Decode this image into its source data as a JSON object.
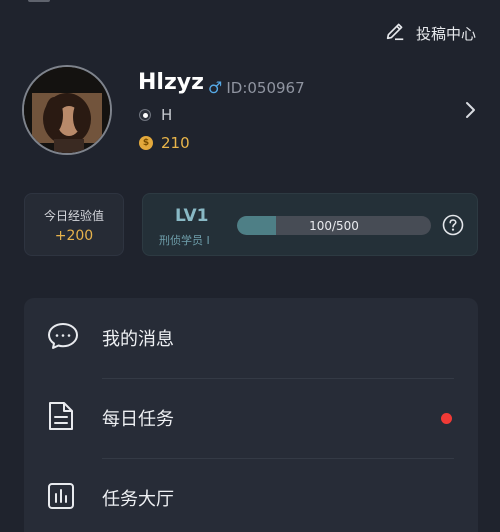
{
  "header": {
    "post_center_label": "投稿中心"
  },
  "profile": {
    "username": "Hlzyz",
    "gender_symbol": "♂",
    "user_id": "ID:050967",
    "tag": "H",
    "coins": "210",
    "coin_symbol": "$"
  },
  "stats": {
    "exp_title": "今日经验值",
    "exp_value": "+200",
    "level": "LV1",
    "rank": "刑侦学员 I",
    "progress_text": "100/500",
    "progress_fraction": 0.2
  },
  "menu": {
    "items": [
      {
        "label": "我的消息",
        "icon": "chat-bubble-icon"
      },
      {
        "label": "每日任务",
        "icon": "document-icon",
        "badge": true
      },
      {
        "label": "任务大厅",
        "icon": "bar-chart-icon"
      }
    ]
  },
  "colors": {
    "background": "#1f232d",
    "accent_gold": "#e6b24c",
    "accent_teal": "#4e7f86",
    "badge_red": "#f03a36",
    "male_blue": "#56a9e6"
  }
}
